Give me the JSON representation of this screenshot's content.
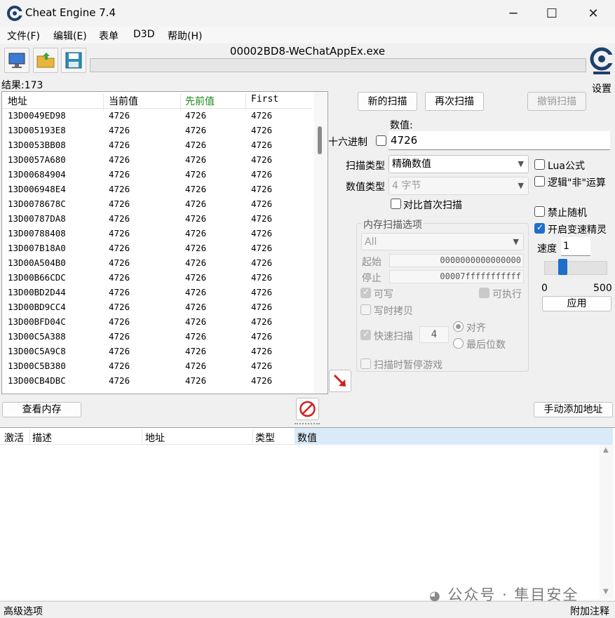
{
  "window": {
    "title": "Cheat Engine 7.4",
    "minimize": "─",
    "maximize": "☐",
    "close": "✕"
  },
  "menu": [
    "文件(F)",
    "编辑(E)",
    "表单",
    "D3D",
    "帮助(H)"
  ],
  "process_title": "00002BD8-WeChatAppEx.exe",
  "settings_label": "设置",
  "result_count": "结果:173",
  "results": {
    "headers": [
      "地址",
      "当前值",
      "先前值",
      "First"
    ],
    "rows": [
      [
        "13D0049ED98",
        "4726",
        "4726",
        "4726"
      ],
      [
        "13D005193E8",
        "4726",
        "4726",
        "4726"
      ],
      [
        "13D0053BB08",
        "4726",
        "4726",
        "4726"
      ],
      [
        "13D0057A680",
        "4726",
        "4726",
        "4726"
      ],
      [
        "13D00684904",
        "4726",
        "4726",
        "4726"
      ],
      [
        "13D006948E4",
        "4726",
        "4726",
        "4726"
      ],
      [
        "13D0078678C",
        "4726",
        "4726",
        "4726"
      ],
      [
        "13D00787DA8",
        "4726",
        "4726",
        "4726"
      ],
      [
        "13D00788408",
        "4726",
        "4726",
        "4726"
      ],
      [
        "13D007B18A0",
        "4726",
        "4726",
        "4726"
      ],
      [
        "13D00A504B0",
        "4726",
        "4726",
        "4726"
      ],
      [
        "13D00B66CDC",
        "4726",
        "4726",
        "4726"
      ],
      [
        "13D00BD2D44",
        "4726",
        "4726",
        "4726"
      ],
      [
        "13D00BD9CC4",
        "4726",
        "4726",
        "4726"
      ],
      [
        "13D00BFD04C",
        "4726",
        "4726",
        "4726"
      ],
      [
        "13D00C5A388",
        "4726",
        "4726",
        "4726"
      ],
      [
        "13D00C5A9C8",
        "4726",
        "4726",
        "4726"
      ],
      [
        "13D00C5B380",
        "4726",
        "4726",
        "4726"
      ],
      [
        "13D00CB4DBC",
        "4726",
        "4726",
        "4726"
      ]
    ]
  },
  "scan": {
    "new_scan": "新的扫描",
    "next_scan": "再次扫描",
    "undo_scan": "撤销扫描",
    "value_label": "数值:",
    "hex_label": "十六进制",
    "value": "4726",
    "scan_type_label": "扫描类型",
    "scan_type": "精确数值",
    "value_type_label": "数值类型",
    "value_type": "4 字节",
    "compare_first": "对比首次扫描",
    "lua_formula": "Lua公式",
    "logic_not": "逻辑\"非\"运算",
    "no_random": "禁止随机",
    "speedhack": "开启变速精灵",
    "speed_label": "速度",
    "speed_value": "1",
    "slider_min": "0",
    "slider_max": "500",
    "apply": "应用"
  },
  "memory": {
    "title": "内存扫描选项",
    "region": "All",
    "start_label": "起始",
    "start_value": "0000000000000000",
    "stop_label": "停止",
    "stop_value": "00007fffffffffff",
    "writable": "可写",
    "executable": "可执行",
    "copy_on_write": "写时拷贝",
    "fast_scan": "快速扫描",
    "fast_scan_value": "4",
    "align": "对齐",
    "last_digits": "最后位数",
    "pause_game": "扫描时暂停游戏"
  },
  "view_memory": "查看内存",
  "add_address": "手动添加地址",
  "lower_table": {
    "headers": [
      "激活",
      "描述",
      "地址",
      "类型",
      "数值"
    ]
  },
  "status": {
    "left": "高级选项",
    "right": "附加注释"
  },
  "watermark": "公众号 · 隼目安全",
  "colors": {
    "previous_header": "#1a8a1a",
    "accent": "#1f6ec9",
    "arrow": "#d02020",
    "stop": "#d02020"
  }
}
